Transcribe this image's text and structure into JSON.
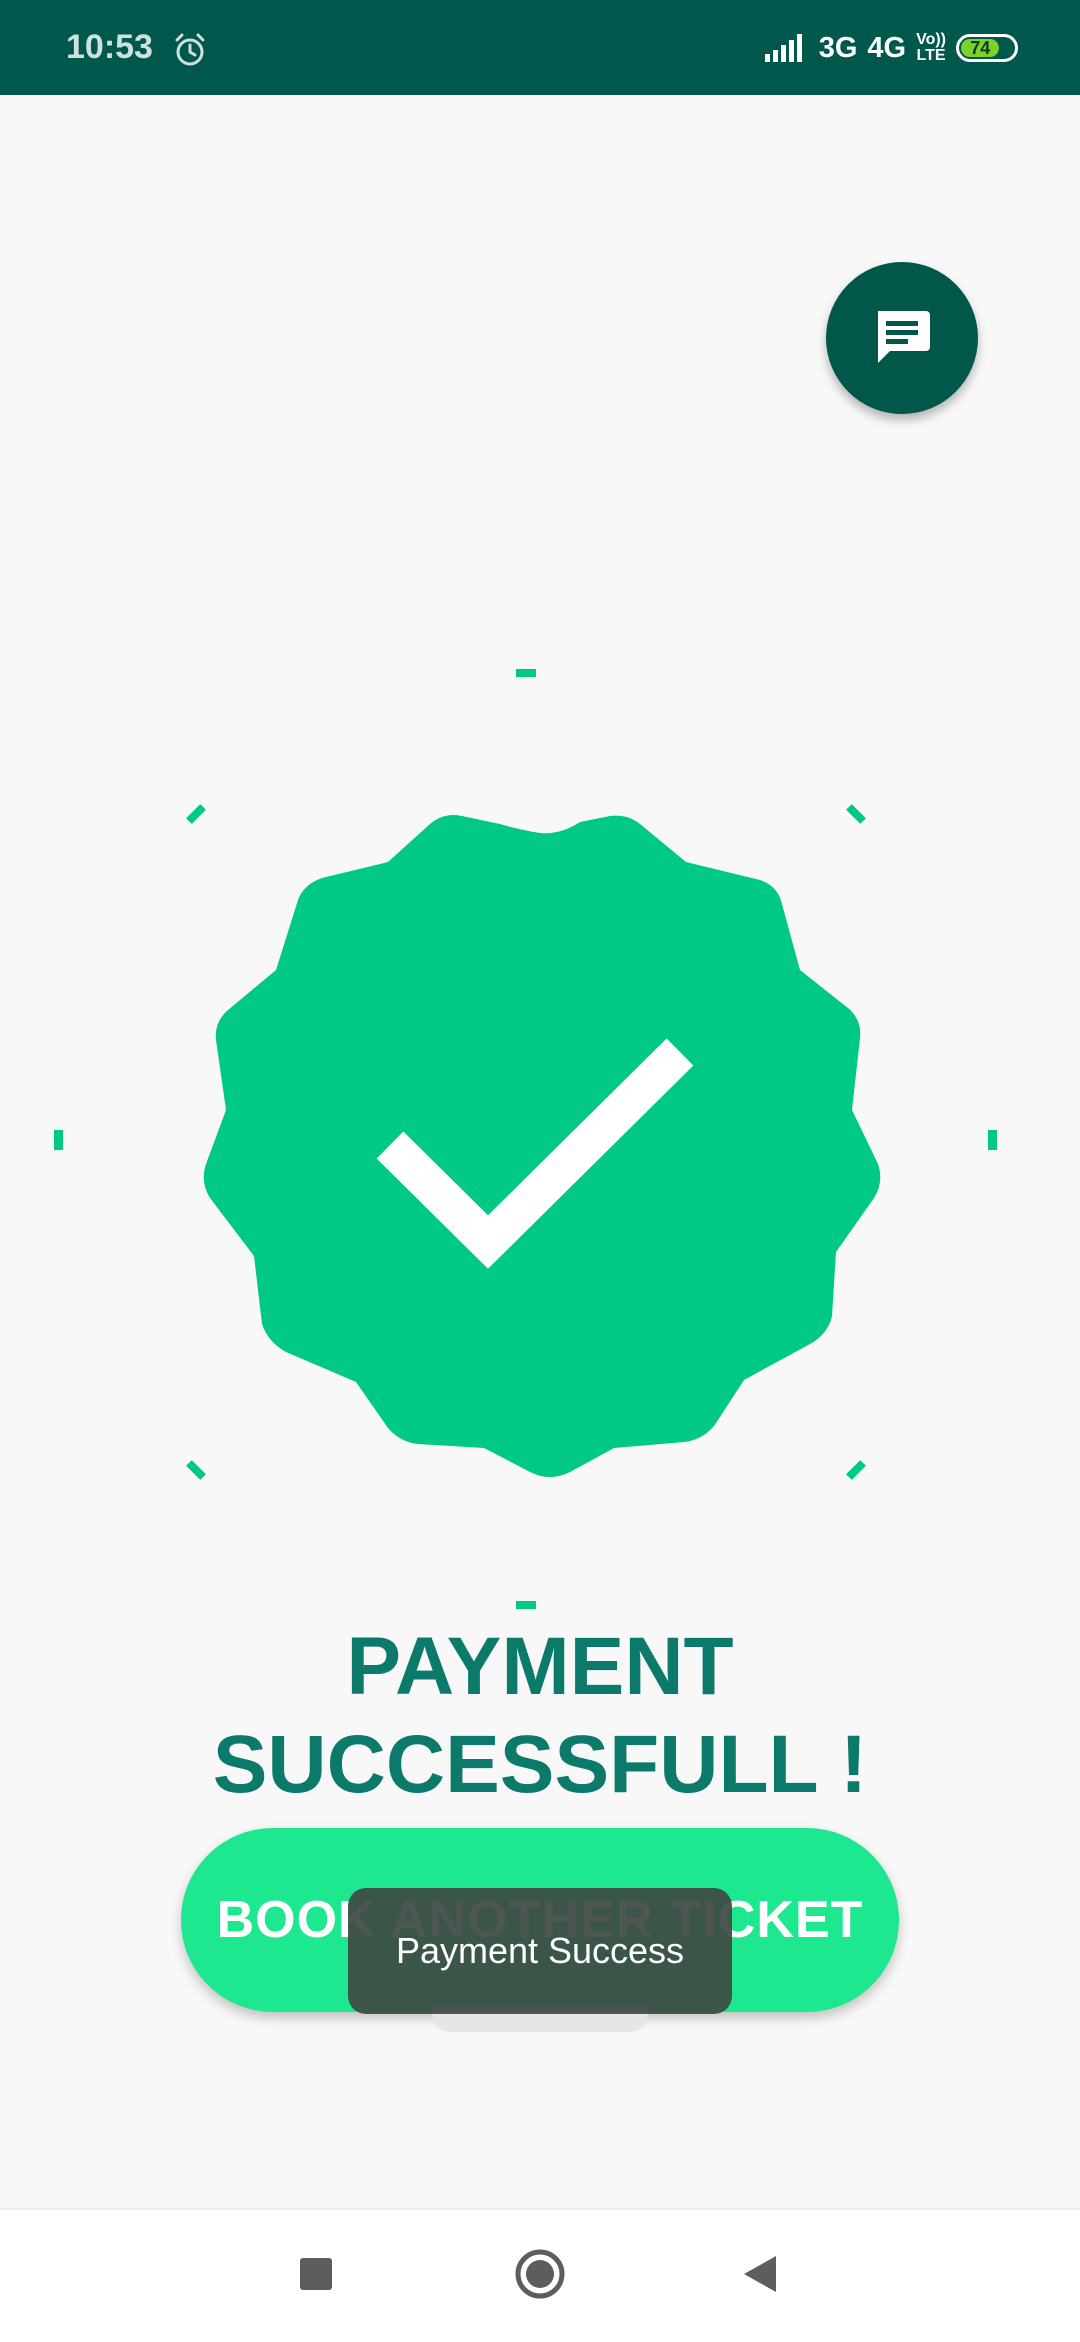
{
  "status_bar": {
    "time": "10:53",
    "network_3g": "3G",
    "network_4g": "4G",
    "volte_top": "Vo))",
    "volte_bottom": "LTE",
    "battery_level": "74"
  },
  "main": {
    "title_line1": "PAYMENT",
    "title_line2": "SUCCESSFULL !",
    "book_button_label": "BOOK ANOTHER TICKET",
    "toast_text": "Payment Success"
  },
  "colors": {
    "status_bar": "#00584c",
    "badge": "#00c986",
    "title": "#0c7a6a",
    "button": "#1de88f",
    "fab": "#00574a"
  },
  "icons": {
    "fab": "chat-icon",
    "badge": "check-badge-icon",
    "nav": [
      "recents-icon",
      "home-icon",
      "back-icon"
    ]
  }
}
